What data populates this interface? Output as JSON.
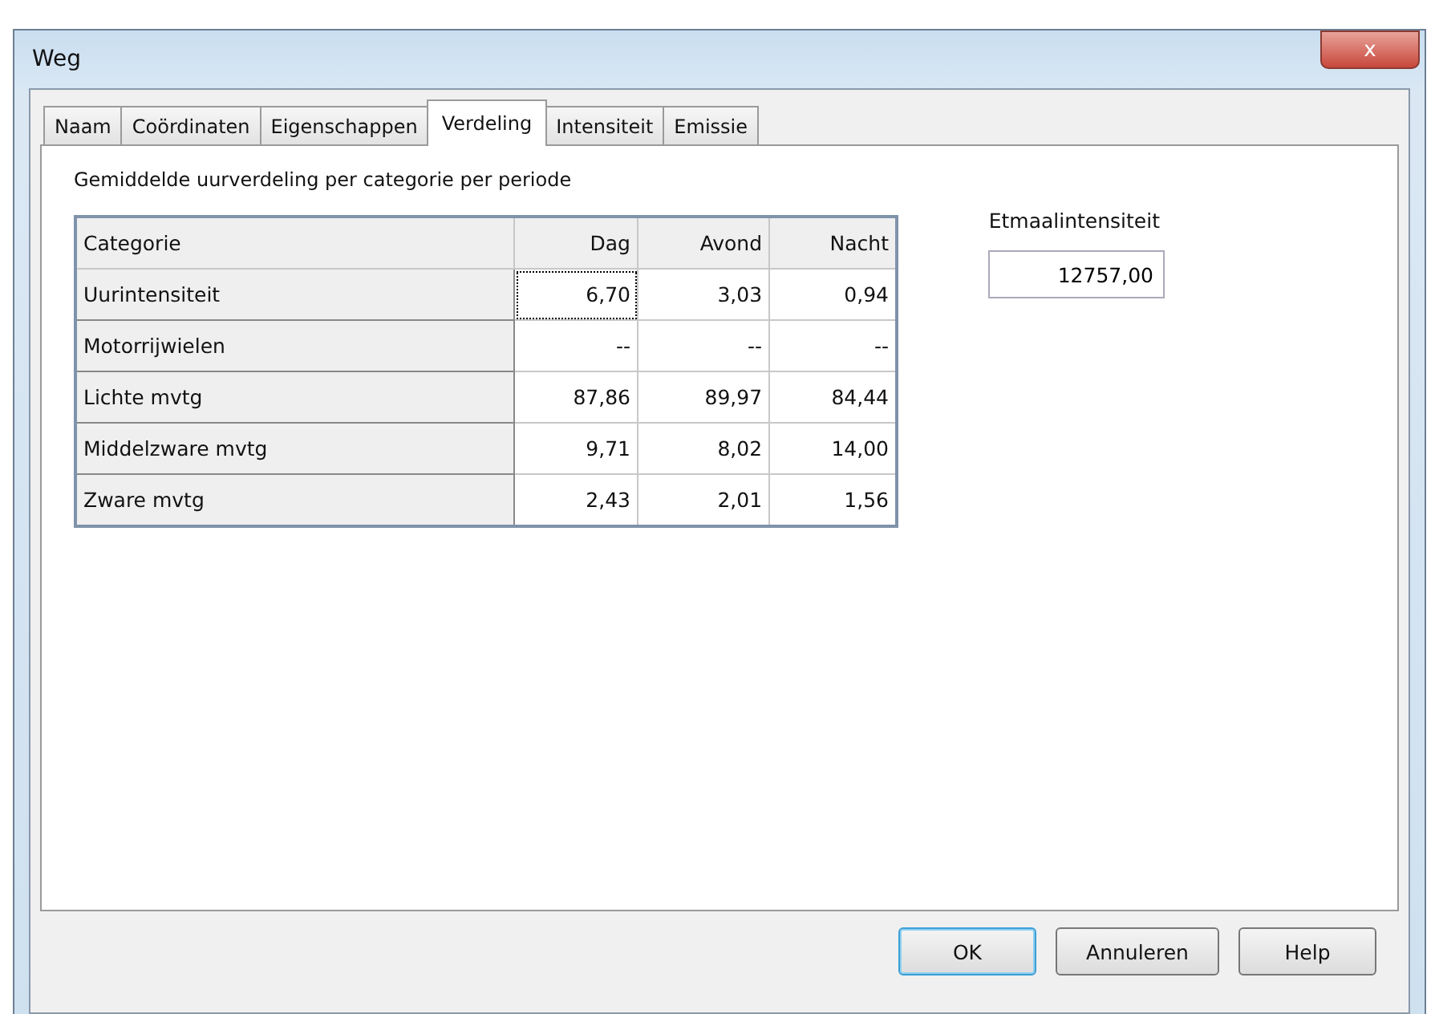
{
  "window": {
    "title": "Weg",
    "close_label": "x"
  },
  "tabs": [
    {
      "label": "Naam",
      "selected": false
    },
    {
      "label": "Coördinaten",
      "selected": false
    },
    {
      "label": "Eigenschappen",
      "selected": false
    },
    {
      "label": "Verdeling",
      "selected": true
    },
    {
      "label": "Intensiteit",
      "selected": false
    },
    {
      "label": "Emissie",
      "selected": false
    }
  ],
  "section_title": "Gemiddelde uurverdeling per categorie per periode",
  "table": {
    "columns": [
      "Categorie",
      "Dag",
      "Avond",
      "Nacht"
    ],
    "rows": [
      {
        "cells": [
          {
            "text": "Uurintensiteit",
            "focused": false
          },
          {
            "text": "6,70",
            "focused": true
          },
          {
            "text": "3,03",
            "focused": false
          },
          {
            "text": "0,94",
            "focused": false
          }
        ]
      },
      {
        "cells": [
          {
            "text": "Motorrijwielen",
            "focused": false
          },
          {
            "text": "--",
            "focused": false
          },
          {
            "text": "--",
            "focused": false
          },
          {
            "text": "--",
            "focused": false
          }
        ]
      },
      {
        "cells": [
          {
            "text": "Lichte mvtg",
            "focused": false
          },
          {
            "text": "87,86",
            "focused": false
          },
          {
            "text": "89,97",
            "focused": false
          },
          {
            "text": "84,44",
            "focused": false
          }
        ]
      },
      {
        "cells": [
          {
            "text": "Middelzware mvtg",
            "focused": false
          },
          {
            "text": "9,71",
            "focused": false
          },
          {
            "text": "8,02",
            "focused": false
          },
          {
            "text": "14,00",
            "focused": false
          }
        ]
      },
      {
        "cells": [
          {
            "text": "Zware mvtg",
            "focused": false
          },
          {
            "text": "2,43",
            "focused": false
          },
          {
            "text": "2,01",
            "focused": false
          },
          {
            "text": "1,56",
            "focused": false
          }
        ]
      }
    ]
  },
  "etmaal": {
    "label": "Etmaalintensiteit",
    "value": "12757,00"
  },
  "buttons": [
    {
      "label": "OK",
      "default": true
    },
    {
      "label": "Annuleren",
      "default": false
    },
    {
      "label": "Help",
      "default": false
    }
  ]
}
